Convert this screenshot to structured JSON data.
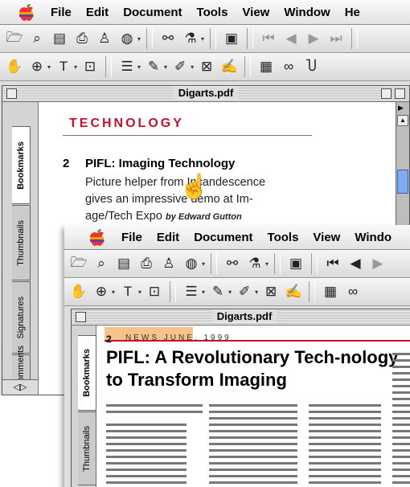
{
  "screens": [
    {
      "menu": [
        "File",
        "Edit",
        "Document",
        "Tools",
        "View",
        "Window",
        "He"
      ],
      "window_title": "Digarts.pdf",
      "tabs": [
        "Bookmarks",
        "Thumbnails",
        "Signatures",
        "Comments"
      ],
      "page": {
        "heading": "TECHNOLOGY",
        "article_number": "2",
        "article_title": "PIFL: Imaging Technology",
        "body_lines": [
          "Picture helper from Incandescence",
          "gives an impressive demo at Im-",
          "age/Tech Expo"
        ],
        "byline": "by Edward Gutton"
      }
    },
    {
      "menu": [
        "File",
        "Edit",
        "Document",
        "Tools",
        "View",
        "Windo"
      ],
      "window_title": "Digarts.pdf",
      "tabs": [
        "Bookmarks",
        "Thumbnails"
      ],
      "page": {
        "article_number": "2",
        "news_line": "NEWS JUNE, 1999",
        "title": "PIFL: A Revolutionary Tech-nology to Transform Imaging"
      }
    }
  ],
  "colors": {
    "accent_red": "#c8102e",
    "highlight": "#f6c38a",
    "scroll_thumb": "#7faaf0"
  },
  "icons": [
    "apple-icon",
    "open-icon",
    "search-icon",
    "save-icon",
    "print-icon",
    "stamp-icon",
    "globe-icon",
    "binoculars-icon",
    "find-icon",
    "layout-icon",
    "first-page-icon",
    "prev-page-icon",
    "next-page-icon",
    "last-page-icon",
    "hand-icon",
    "zoom-icon",
    "text-select-icon",
    "crop-icon",
    "note-icon",
    "pencil-icon",
    "highlighter-icon",
    "stamp-icon",
    "signature-icon",
    "film-icon",
    "link-icon",
    "touchup-icon",
    "pointer-hand-icon"
  ]
}
